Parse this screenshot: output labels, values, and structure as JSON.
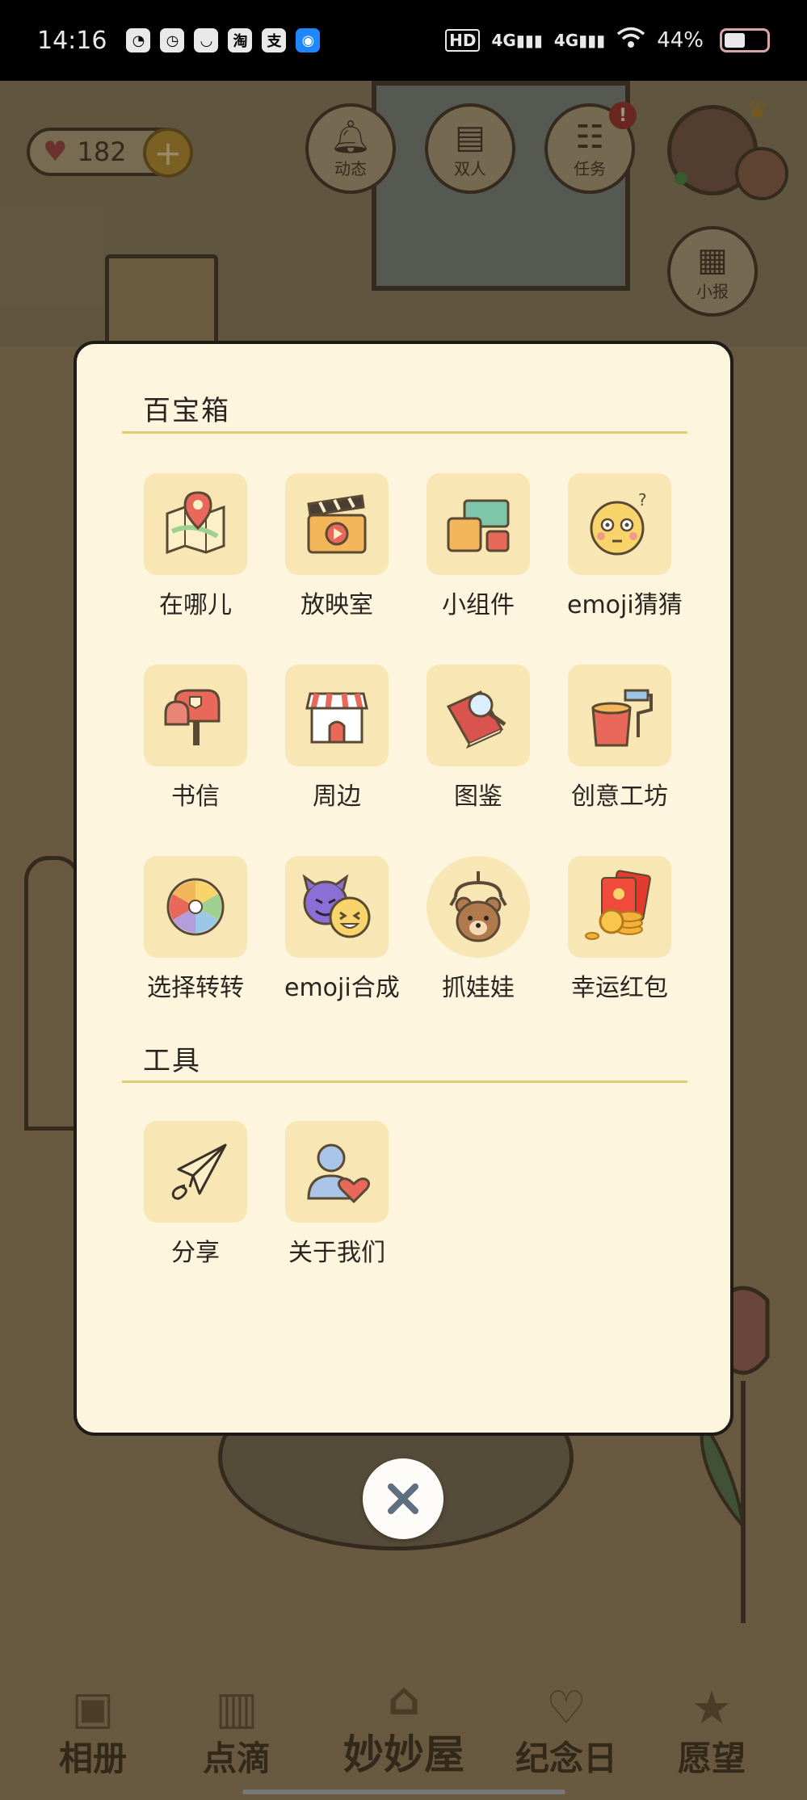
{
  "status_bar": {
    "time": "14:16",
    "app_icons": [
      "qq-icon",
      "speed-icon",
      "cup-icon",
      "taobao-icon",
      "alipay-icon",
      "app-icon"
    ],
    "network_label": "HD",
    "signal1": "4G",
    "signal2": "4G",
    "battery": "44%",
    "battery_level": 0.44
  },
  "header": {
    "likes_count": "182",
    "buttons": [
      {
        "label": "动态",
        "icon": "bell-icon"
      },
      {
        "label": "双人",
        "icon": "bed-icon"
      },
      {
        "label": "任务",
        "icon": "clipboard-icon",
        "badge": "!"
      }
    ],
    "newspaper_label": "小报"
  },
  "dialog": {
    "section1_title": "百宝箱",
    "section2_title": "工具",
    "treasure_items": [
      {
        "label": "在哪儿",
        "icon": "map-pin-icon"
      },
      {
        "label": "放映室",
        "icon": "clapperboard-icon"
      },
      {
        "label": "小组件",
        "icon": "widget-icon"
      },
      {
        "label": "emoji猜猜",
        "icon": "emoji-face-icon"
      },
      {
        "label": "书信",
        "icon": "mailbox-icon"
      },
      {
        "label": "周边",
        "icon": "shop-icon"
      },
      {
        "label": "图鉴",
        "icon": "book-magnifier-icon"
      },
      {
        "label": "创意工坊",
        "icon": "paint-bucket-icon"
      },
      {
        "label": "选择转转",
        "icon": "color-wheel-icon"
      },
      {
        "label": "emoji合成",
        "icon": "devil-emoji-icon"
      },
      {
        "label": "抓娃娃",
        "icon": "claw-bear-icon"
      },
      {
        "label": "幸运红包",
        "icon": "red-envelope-icon"
      }
    ],
    "tool_items": [
      {
        "label": "分享",
        "icon": "paper-plane-icon"
      },
      {
        "label": "关于我们",
        "icon": "person-heart-icon"
      }
    ]
  },
  "bottom_nav": {
    "items": [
      "相册",
      "点滴",
      "妙妙屋",
      "纪念日",
      "愿望"
    ]
  },
  "colors": {
    "dialog_bg": "#fdf5de",
    "tile_bg": "#f8e6b5",
    "divider": "#e3cc72"
  }
}
